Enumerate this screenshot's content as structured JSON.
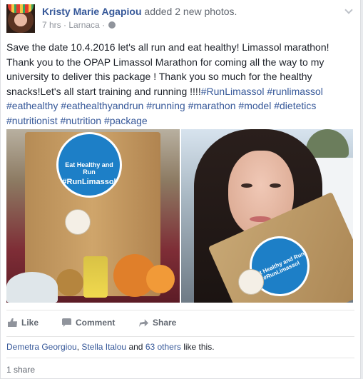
{
  "post": {
    "author": "Kristy Marie Agapiou",
    "action": "added 2 new photos.",
    "time": "7 hrs",
    "location": "Larnaca",
    "separator1": " · ",
    "separator2": " · "
  },
  "body": {
    "text": "Save the date 10.4.2016 let's all run and eat healthy! Limassol marathon! Thank you to the OPAP Limassol Marathon for coming all the way to my university to deliver this package ! Thank you so much for the healthy snacks!Let's all start training and running !!!!",
    "hashtags_line1": [
      "#RunLimassol",
      "#runlimassol"
    ],
    "hashtags_line2": [
      "#eathealthy",
      "#eathealthyandrun",
      "#running",
      "#marathon",
      "#model",
      "#dietetics"
    ],
    "hashtags_line3": [
      "#nutritionist",
      "#nutrition",
      "#package"
    ]
  },
  "photos": {
    "sticker1_line1": "Eat Healthy and Run",
    "sticker1_line2": "#RunLimassol",
    "sticker2_line1": "Eat Healthy and Run",
    "sticker2_line2": "#RunLimassol"
  },
  "actions": {
    "like": "Like",
    "comment": "Comment",
    "share": "Share"
  },
  "reactions": {
    "name1": "Demetra Georgiou",
    "name2": "Stella Italou",
    "others": "63 others",
    "and": " and ",
    "comma": ", ",
    "suffix": " like this."
  },
  "shares": {
    "count": "1 share"
  },
  "colors": {
    "link": "#365899",
    "brand_blue": "#1d7fc7",
    "muted": "#90949c"
  },
  "icons": [
    "avatar",
    "globe-icon",
    "chevron-down-icon",
    "like-icon",
    "comment-icon",
    "share-icon"
  ]
}
